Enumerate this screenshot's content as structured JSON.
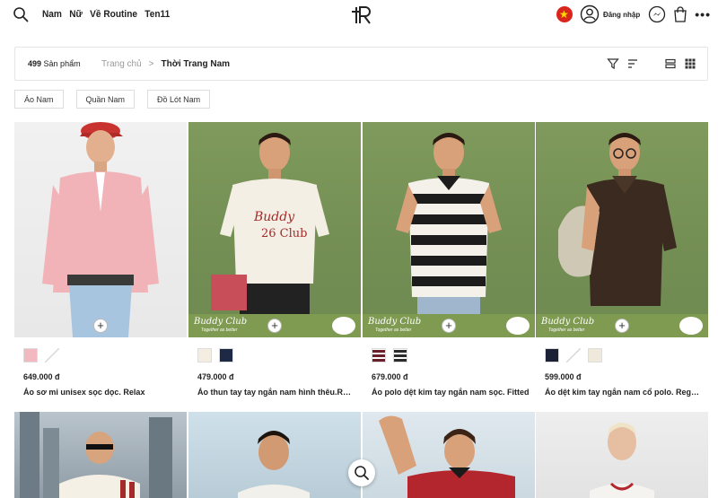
{
  "header": {
    "nav": [
      "Nam",
      "Nữ",
      "Về Routine",
      "Ten11"
    ],
    "login": "Đăng nhập",
    "icons": [
      "search-icon",
      "user-icon",
      "messenger-icon",
      "cart-icon",
      "more-icon"
    ]
  },
  "toolbar": {
    "count_number": "499",
    "count_label": "Sản phẩm",
    "breadcrumb_home": "Trang chủ",
    "breadcrumb_sep": ">",
    "breadcrumb_current": "Thời Trang Nam"
  },
  "chips": [
    "Áo Nam",
    "Quần Nam",
    "Đồ Lót Nam"
  ],
  "banner": {
    "script": "Buddy Club",
    "tagline": "Together as better"
  },
  "products": [
    {
      "price": "649.000 đ",
      "name": "Áo sơ mi unisex sọc dọc. Relax",
      "swatches": [
        "#f2b9c1",
        "#ffffff"
      ]
    },
    {
      "price": "479.000 đ",
      "name": "Áo thun tay tay ngắn nam hình thêu.Regular",
      "swatches": [
        "#f4eee2",
        "#1e2a45"
      ]
    },
    {
      "price": "679.000 đ",
      "name": "Áo polo dệt kim tay ngắn nam sọc. Fitted",
      "swatches": [
        "#6b1f2a",
        "#2b2b2b"
      ]
    },
    {
      "price": "599.000 đ",
      "name": "Áo dệt kim tay ngắn nam cổ polo. Regular",
      "swatches": [
        "#1b2235",
        "#ffffff",
        "#efe9dc"
      ]
    }
  ],
  "colors": {
    "banner_green": "#7f9a51",
    "flag_red": "#da251d"
  }
}
